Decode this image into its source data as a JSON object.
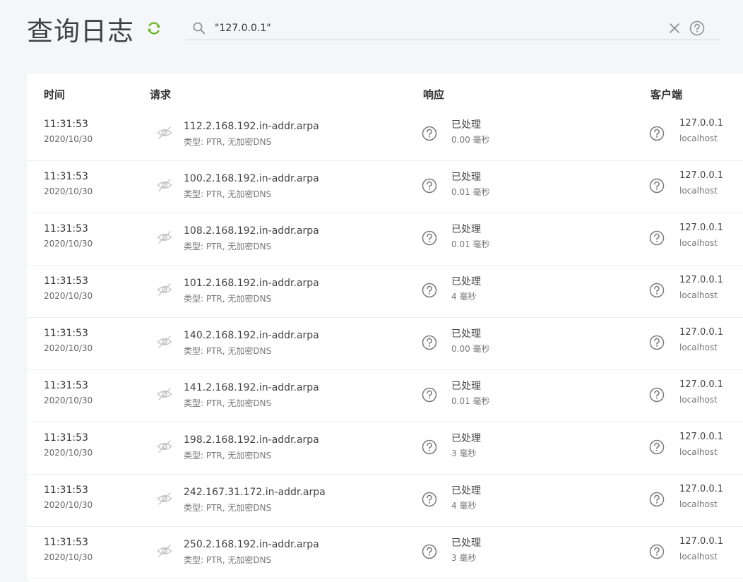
{
  "header": {
    "title": "查询日志",
    "refresh_icon": "refresh-icon",
    "accent": "#67b21a"
  },
  "search": {
    "value": "\"127.0.0.1\"",
    "icons": [
      "search-icon",
      "clear-icon",
      "help-icon"
    ]
  },
  "table": {
    "columns": [
      "时间",
      "请求",
      "响应",
      "客户端"
    ],
    "rows": [
      {
        "time": "11:31:53",
        "date": "2020/10/30",
        "domain": "112.2.168.192.in-addr.arpa",
        "type": "类型: PTR, 无加密DNS",
        "status": "已处理",
        "elapsed": "0.00 毫秒",
        "client_ip": "127.0.0.1",
        "client_name": "localhost"
      },
      {
        "time": "11:31:53",
        "date": "2020/10/30",
        "domain": "100.2.168.192.in-addr.arpa",
        "type": "类型: PTR, 无加密DNS",
        "status": "已处理",
        "elapsed": "0.01 毫秒",
        "client_ip": "127.0.0.1",
        "client_name": "localhost"
      },
      {
        "time": "11:31:53",
        "date": "2020/10/30",
        "domain": "108.2.168.192.in-addr.arpa",
        "type": "类型: PTR, 无加密DNS",
        "status": "已处理",
        "elapsed": "0.01 毫秒",
        "client_ip": "127.0.0.1",
        "client_name": "localhost"
      },
      {
        "time": "11:31:53",
        "date": "2020/10/30",
        "domain": "101.2.168.192.in-addr.arpa",
        "type": "类型: PTR, 无加密DNS",
        "status": "已处理",
        "elapsed": "4 毫秒",
        "client_ip": "127.0.0.1",
        "client_name": "localhost"
      },
      {
        "time": "11:31:53",
        "date": "2020/10/30",
        "domain": "140.2.168.192.in-addr.arpa",
        "type": "类型: PTR, 无加密DNS",
        "status": "已处理",
        "elapsed": "0.00 毫秒",
        "client_ip": "127.0.0.1",
        "client_name": "localhost"
      },
      {
        "time": "11:31:53",
        "date": "2020/10/30",
        "domain": "141.2.168.192.in-addr.arpa",
        "type": "类型: PTR, 无加密DNS",
        "status": "已处理",
        "elapsed": "0.01 毫秒",
        "client_ip": "127.0.0.1",
        "client_name": "localhost"
      },
      {
        "time": "11:31:53",
        "date": "2020/10/30",
        "domain": "198.2.168.192.in-addr.arpa",
        "type": "类型: PTR, 无加密DNS",
        "status": "已处理",
        "elapsed": "3 毫秒",
        "client_ip": "127.0.0.1",
        "client_name": "localhost"
      },
      {
        "time": "11:31:53",
        "date": "2020/10/30",
        "domain": "242.167.31.172.in-addr.arpa",
        "type": "类型: PTR, 无加密DNS",
        "status": "已处理",
        "elapsed": "4 毫秒",
        "client_ip": "127.0.0.1",
        "client_name": "localhost"
      },
      {
        "time": "11:31:53",
        "date": "2020/10/30",
        "domain": "250.2.168.192.in-addr.arpa",
        "type": "类型: PTR, 无加密DNS",
        "status": "已处理",
        "elapsed": "3 毫秒",
        "client_ip": "127.0.0.1",
        "client_name": "localhost"
      }
    ]
  }
}
